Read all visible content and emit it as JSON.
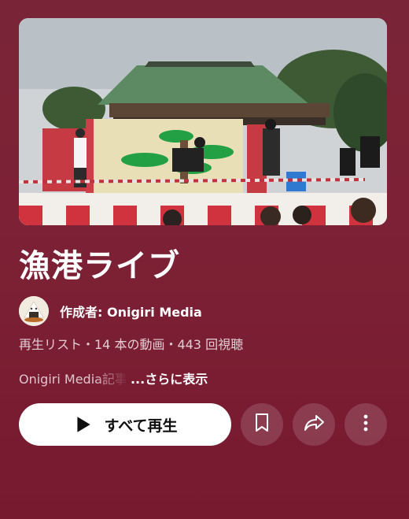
{
  "playlist": {
    "title": "漁港ライブ",
    "creator": "作成者: Onigiri Media",
    "meta": "再生リスト・14 本の動画・443 回視聴",
    "description_preview": "Onigiri Media記事",
    "more_label": "...さらに表示"
  },
  "actions": {
    "play_all_label": "すべて再生",
    "play_icon": "play-icon",
    "save_icon": "bookmark-icon",
    "share_icon": "share-icon",
    "more_icon": "more-vertical-icon"
  },
  "colors": {
    "background": "#7a2437",
    "button_primary": "#ffffff",
    "button_secondary": "rgba(255,255,255,0.14)"
  }
}
